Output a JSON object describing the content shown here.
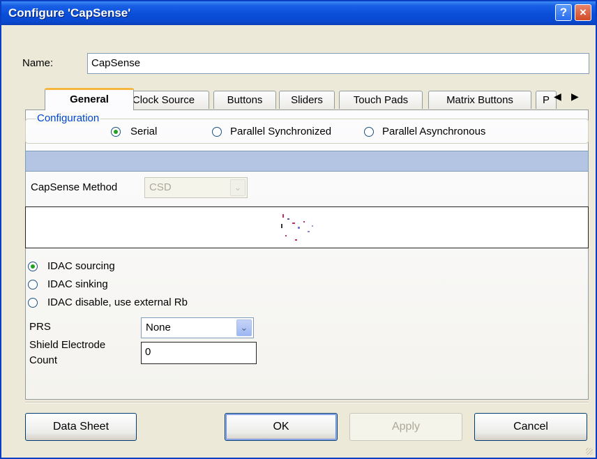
{
  "window": {
    "title": "Configure 'CapSense'",
    "help_icon": "?",
    "close_icon": "×"
  },
  "name_field": {
    "label": "Name:",
    "value": "CapSense"
  },
  "tabs": [
    {
      "label": "General",
      "active": true
    },
    {
      "label": "Clock Source"
    },
    {
      "label": "Buttons"
    },
    {
      "label": "Sliders"
    },
    {
      "label": "Touch Pads"
    },
    {
      "label": "Matrix Buttons"
    },
    {
      "label": "P"
    }
  ],
  "tab_scroll": {
    "left": "◀",
    "right": "▶"
  },
  "configuration": {
    "legend": "Configuration",
    "options": [
      {
        "label": "Serial",
        "checked": true
      },
      {
        "label": "Parallel Synchronized",
        "checked": false
      },
      {
        "label": "Parallel Asynchronous",
        "checked": false
      }
    ]
  },
  "capsense_method": {
    "label": "CapSense Method",
    "value": "CSD",
    "enabled": false,
    "arrow": "⌄"
  },
  "idac": {
    "options": [
      {
        "label": "IDAC sourcing",
        "checked": true
      },
      {
        "label": "IDAC sinking",
        "checked": false
      },
      {
        "label": "IDAC disable, use external Rb",
        "checked": false
      }
    ]
  },
  "prs": {
    "label": "PRS",
    "value": "None",
    "arrow": "⌄"
  },
  "shield": {
    "label_line1": "Shield Electrode",
    "label_line2": "Count",
    "value": "0"
  },
  "buttons": {
    "datasheet": "Data Sheet",
    "ok": "OK",
    "apply": "Apply",
    "cancel": "Cancel"
  },
  "colors": {
    "titlebar": "#0a4ed8",
    "dialog_bg": "#ece9d8",
    "tab_active_accent": "#f6b740",
    "group_legend": "#0046d5"
  }
}
